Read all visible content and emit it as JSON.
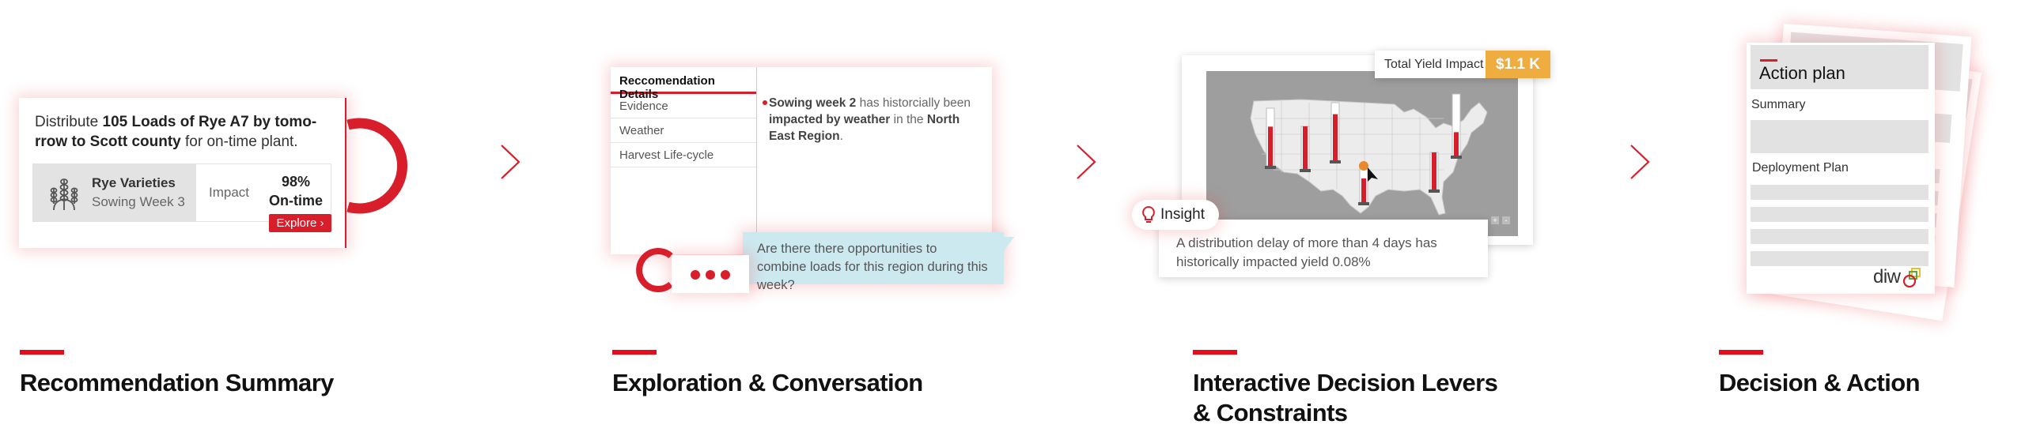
{
  "colors": {
    "accent": "#d81e2a",
    "bubble": "#cde9f0",
    "yield_badge": "#f0ad3f",
    "map_bg": "#9e9e9e",
    "map_land": "#ececec"
  },
  "steps": [
    {
      "title": "Recommendation Summary"
    },
    {
      "title": "Exploration & Conversation"
    },
    {
      "title_line1": "Interactive Decision Levers",
      "title_line2": "& Constraints"
    },
    {
      "title": "Decision & Action"
    }
  ],
  "recommendation": {
    "text_1": "Distribute ",
    "text_bold": "105 Loads of Rye A7 by tomo-rrow to Scott county",
    "text_2": " for on-time plant.",
    "icon": "wheat-icon",
    "variety_title": "Rye Varieties",
    "variety_sub": "Sowing Week 3",
    "impact_label": "Impact",
    "impact_value": "98%",
    "impact_unit": "On-time",
    "explore_label": "Explore ›"
  },
  "exploration": {
    "tab_header": "Reccomendation Details",
    "tabs": [
      "Evidence",
      "Weather",
      "Harvest Life-cycle"
    ],
    "detail_bold_1": "Sowing week 2",
    "detail_1": " has historcially been ",
    "detail_bold_2": "impacted by weather",
    "detail_2": " in the ",
    "detail_bold_3": "North East Region",
    "detail_3": ".",
    "question": "Are there there opportunities to combine loads for this region during this week?"
  },
  "levers": {
    "yield_label": "Total Yield Impact",
    "yield_value": "$1.1 K",
    "zoom_in": "+",
    "zoom_out": "-",
    "insight_label": "Insight",
    "insight_text": "A distribution delay of more than 4 days has historically impacted yield 0.08%",
    "bar_fill_levels": [
      0.68,
      1.0,
      0.8,
      0.7,
      1.0,
      0.38
    ]
  },
  "action": {
    "title": "Action plan",
    "summary": "Summary",
    "deployment": "Deployment Plan",
    "logo": "diwo"
  }
}
